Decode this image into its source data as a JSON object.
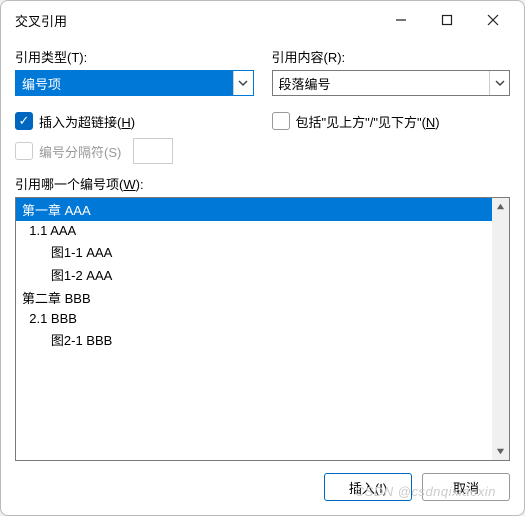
{
  "window": {
    "title": "交叉引用"
  },
  "labels": {
    "ref_type": "引用类型(T):",
    "ref_content": "引用内容(R):",
    "insert_hyperlink_pre": "插入为超链接(",
    "insert_hyperlink_u": "H",
    "insert_hyperlink_post": ")",
    "include_pre": "包括\"见上方\"/\"见下方\"(",
    "include_u": "N",
    "include_post": ")",
    "separator": "编号分隔符(S)",
    "which_item_pre": "引用哪一个编号项(",
    "which_item_u": "W",
    "which_item_post": "):"
  },
  "values": {
    "ref_type": "编号项",
    "ref_content": "段落编号"
  },
  "checks": {
    "hyperlink": true,
    "include": false,
    "separator": false
  },
  "list": {
    "items": [
      "第一章 AAA",
      "  1.1 AAA",
      "        图1-1 AAA",
      "        图1-2 AAA",
      "第二章 BBB",
      "  2.1 BBB",
      "        图2-1 BBB"
    ],
    "selected": 0
  },
  "buttons": {
    "insert": "插入(I)",
    "cancel": "取消"
  },
  "watermark": "CSDN @csdnqixiaoxin"
}
